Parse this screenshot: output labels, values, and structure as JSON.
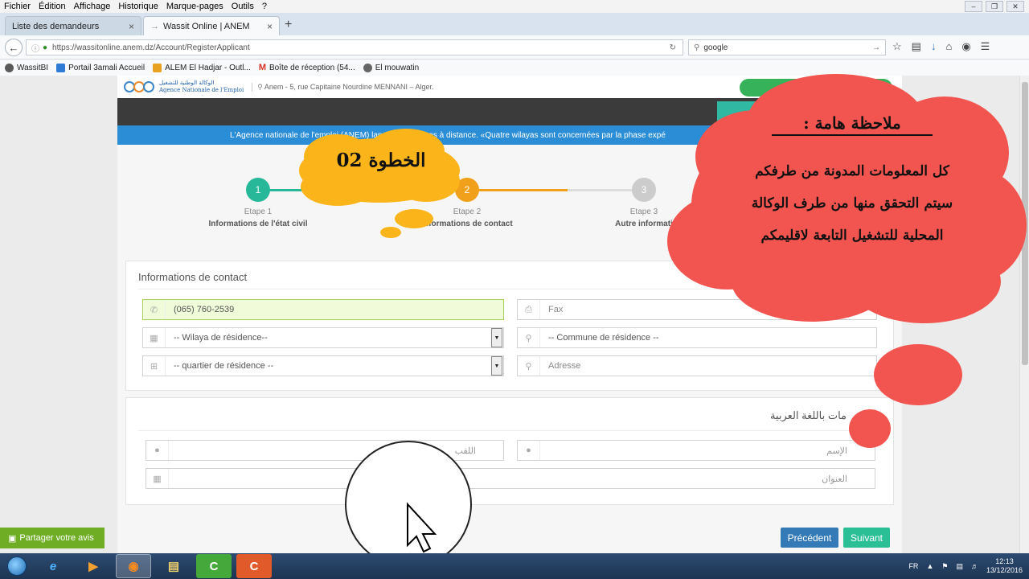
{
  "menu": [
    "Fichier",
    "Édition",
    "Affichage",
    "Historique",
    "Marque-pages",
    "Outils",
    "?"
  ],
  "tabs": [
    {
      "label": "Liste des demandeurs",
      "active": false
    },
    {
      "label": "Wassit Online | ANEM",
      "active": true
    }
  ],
  "nav": {
    "url": "https://wassitonline.anem.dz/Account/RegisterApplicant",
    "search": "google"
  },
  "bookmarks": [
    {
      "label": "WassitBI",
      "color": "#5a5a5a"
    },
    {
      "label": "Portail 3amali Accueil",
      "color": "#2e7bd6"
    },
    {
      "label": "ALEM El Hadjar - Outl...",
      "color": "#e8a21f"
    },
    {
      "label": "Boîte de réception (54...",
      "color": "#d93025"
    },
    {
      "label": "El mouwatin",
      "color": "#666666"
    }
  ],
  "site": {
    "logo_ar": "الوكالة الوطنية للتشغيل",
    "logo_fr": "Agence Nationale de l'Emploi",
    "address": "Anem - 5, rue Capitaine Nourdine MENNANI – Alger.",
    "banner": "L'Agence nationale de l'emploi (ANEM) lance ses services à distance. «Quatre wilayas sont concernées par la phase expé"
  },
  "steps": [
    {
      "number": "1",
      "label": "Etape 1",
      "title": "Informations de l'état civil",
      "color": "#27b89a"
    },
    {
      "number": "2",
      "label": "Etape 2",
      "title": "Informations de contact",
      "color": "#f0a01a"
    },
    {
      "number": "3",
      "label": "Etape 3",
      "title": "Autre informati",
      "color": "#cccccc"
    }
  ],
  "contact": {
    "title": "Informations de contact",
    "phone": "(065) 760-2539",
    "fax_placeholder": "Fax",
    "wilaya": "-- Wilaya de résidence--",
    "commune": "-- Commune de résidence --",
    "quartier": "-- quartier de résidence --",
    "adresse_placeholder": "Adresse"
  },
  "arabic": {
    "title": "مات باللغة العربية",
    "nom_placeholder": "اللقب",
    "prenom_placeholder": "الإسم",
    "adresse_placeholder": "العنوان"
  },
  "buttons": {
    "prev": "Précédent",
    "next": "Suivant"
  },
  "share": "Partager votre avis",
  "annotations": {
    "step": "الخطوة 02",
    "note_title": "ملاحظة هامة :",
    "note_lines": [
      "كل المعلومات المدونة من طرفكم",
      "سيتم التحقق منها من طرف الوكالة",
      "المحلية للتشغيل التابعة لاقليمكم"
    ]
  },
  "taskbar": {
    "lang": "FR",
    "time": "12:13",
    "date": "13/12/2016"
  }
}
